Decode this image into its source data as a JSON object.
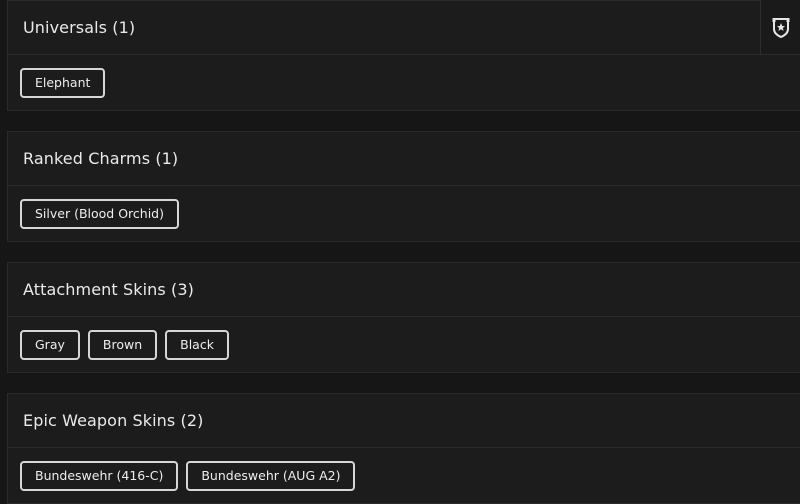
{
  "sections": [
    {
      "title": "Universals (1)",
      "items": [
        "Elephant"
      ],
      "header_icon": "rank-shield-icon"
    },
    {
      "title": "Ranked Charms (1)",
      "items": [
        "Silver (Blood Orchid)"
      ]
    },
    {
      "title": "Attachment Skins (3)",
      "items": [
        "Gray",
        "Brown",
        "Black"
      ]
    },
    {
      "title": "Epic Weapon Skins (2)",
      "items": [
        "Bundeswehr (416-C)",
        "Bundeswehr (AUG A2)"
      ]
    }
  ]
}
